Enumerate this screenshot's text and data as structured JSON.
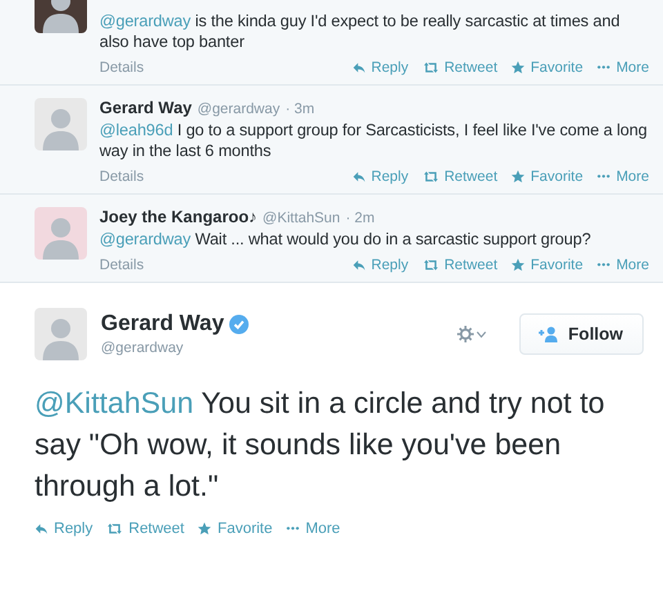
{
  "replies": [
    {
      "mention": "@gerardway",
      "text": " is the kinda guy I'd expect to be really sarcastic at times and also have top banter",
      "details": "Details",
      "actions": [
        {
          "kind": "reply",
          "label": "Reply"
        },
        {
          "kind": "retweet",
          "label": "Retweet"
        },
        {
          "kind": "favorite",
          "label": "Favorite"
        },
        {
          "kind": "more",
          "label": "More"
        }
      ]
    },
    {
      "name": "Gerard Way",
      "handle": "@gerardway",
      "time": "· 3m",
      "mention": "@leah96d",
      "text": " I go to a support group for Sarcasticists, I feel like I've come a long way in the last 6 months",
      "details": "Details",
      "actions": [
        {
          "kind": "reply",
          "label": "Reply"
        },
        {
          "kind": "retweet",
          "label": "Retweet"
        },
        {
          "kind": "favorite",
          "label": "Favorite"
        },
        {
          "kind": "more",
          "label": "More"
        }
      ]
    },
    {
      "name": "Joey the Kangaroo♪",
      "handle": "@KittahSun",
      "time": "· 2m",
      "mention": "@gerardway",
      "text": " Wait ... what would you do in a sarcastic support group?",
      "details": "Details",
      "actions": [
        {
          "kind": "reply",
          "label": "Reply"
        },
        {
          "kind": "retweet",
          "label": "Retweet"
        },
        {
          "kind": "favorite",
          "label": "Favorite"
        },
        {
          "kind": "more",
          "label": "More"
        }
      ]
    }
  ],
  "main_tweet": {
    "name": "Gerard Way",
    "verified": true,
    "handle": "@gerardway",
    "follow_label": "Follow",
    "mention": "@KittahSun",
    "text": " You sit in a circle and try not to say \"Oh wow, it sounds like you've been through a lot.\"",
    "actions": [
      {
        "kind": "reply",
        "label": "Reply"
      },
      {
        "kind": "retweet",
        "label": "Retweet"
      },
      {
        "kind": "favorite",
        "label": "Favorite"
      },
      {
        "kind": "more",
        "label": "More"
      }
    ]
  }
}
